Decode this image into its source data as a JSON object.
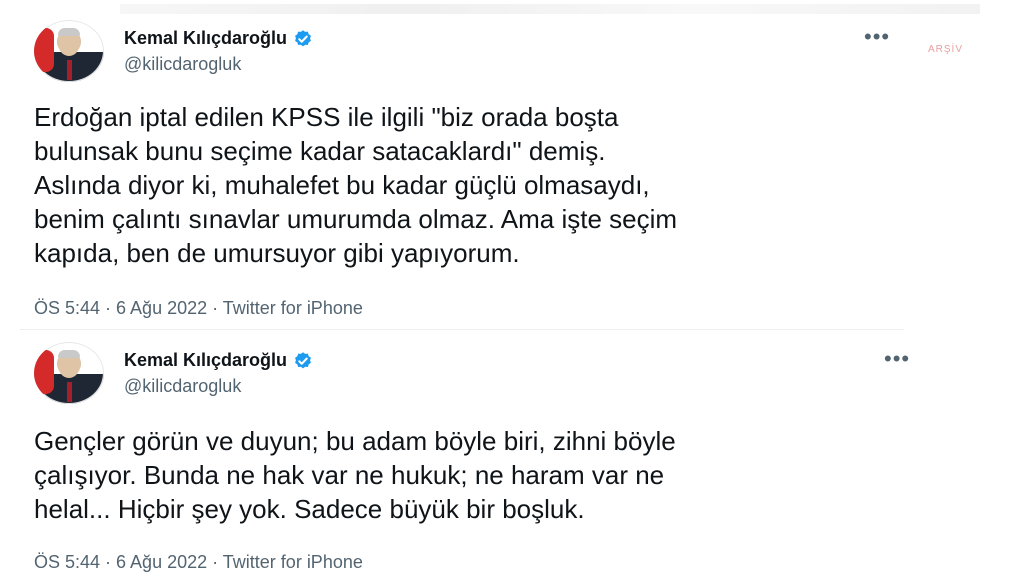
{
  "watermark": "ARŞİV",
  "tweets": [
    {
      "author_name": "Kemal Kılıçdaroğlu",
      "handle": "@kilicdarogluk",
      "text": "Erdoğan iptal edilen KPSS ile ilgili \"biz orada boşta\nbulunsak bunu seçime kadar satacaklardı\" demiş.\nAslında diyor ki, muhalefet bu kadar güçlü olmasaydı,\nbenim çalıntı sınavlar umurumda olmaz. Ama işte seçim\nkapıda, ben de umursuyor gibi yapıyorum.",
      "meta": "ÖS 5:44 · 6 Ağu 2022 · Twitter for iPhone",
      "more_label": "•••"
    },
    {
      "author_name": "Kemal Kılıçdaroğlu",
      "handle": "@kilicdarogluk",
      "text": "Gençler görün ve duyun; bu adam böyle biri, zihni böyle\nçalışıyor. Bunda ne hak var ne hukuk; ne haram var ne\nhelal... Hiçbir şey yok. Sadece büyük bir boşluk.",
      "meta": "ÖS 5:44 · 6 Ağu 2022 · Twitter for iPhone",
      "more_label": "•••"
    }
  ],
  "icons": {
    "verified": "verified-badge-icon",
    "more": "more-options-icon",
    "avatar": "profile-photo"
  },
  "colors": {
    "verified": "#1d9bf0",
    "text": "#0f1419",
    "muted": "#536471"
  }
}
